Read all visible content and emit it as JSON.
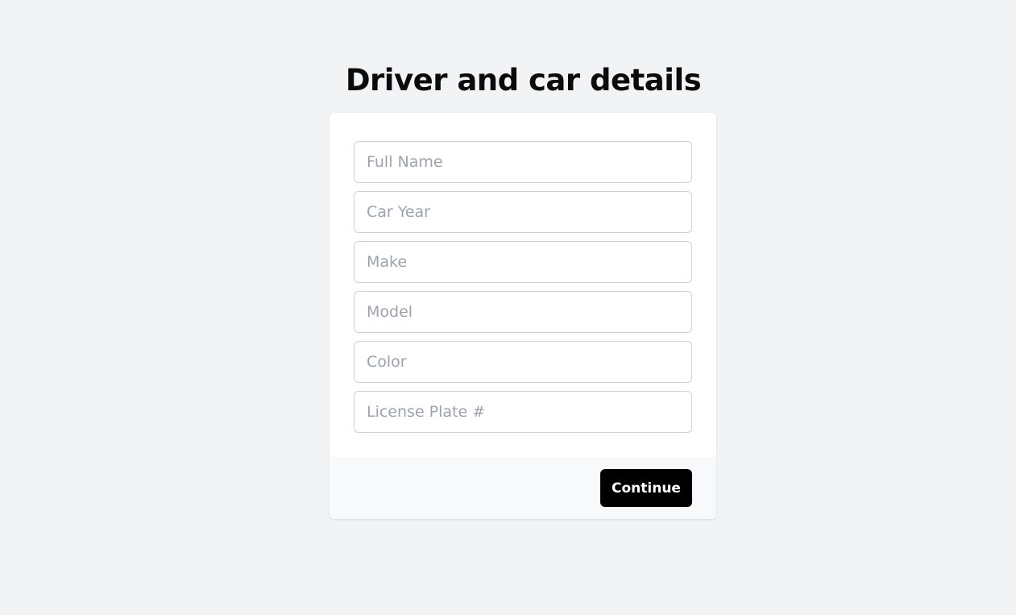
{
  "page": {
    "title": "Driver and car details"
  },
  "form": {
    "fields": [
      {
        "placeholder": "Full Name",
        "value": ""
      },
      {
        "placeholder": "Car Year",
        "value": ""
      },
      {
        "placeholder": "Make",
        "value": ""
      },
      {
        "placeholder": "Model",
        "value": ""
      },
      {
        "placeholder": "Color",
        "value": ""
      },
      {
        "placeholder": "License Plate #",
        "value": ""
      }
    ],
    "continue_label": "Continue"
  },
  "colors": {
    "background": "#f2f3f5",
    "card": "#ffffff",
    "footer": "#f8f9fb",
    "button": "#000000",
    "button_text": "#ffffff",
    "placeholder": "#9ca3af"
  }
}
